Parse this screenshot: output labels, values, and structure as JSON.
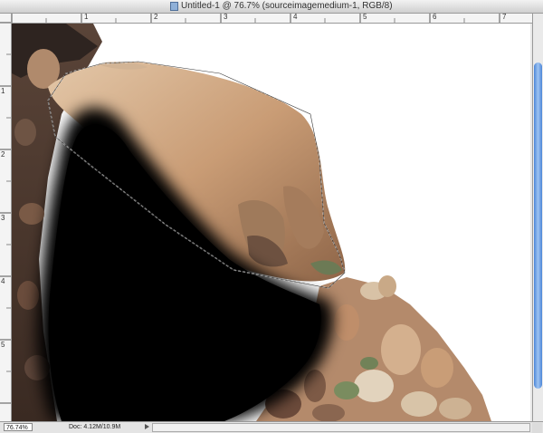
{
  "window": {
    "title": "Untitled-1 @ 76.7% (sourceimagemedium-1, RGB/8)"
  },
  "rulers": {
    "top_labels": [
      "1",
      "2",
      "3",
      "4",
      "5",
      "6",
      "7"
    ],
    "left_labels": [
      "1",
      "2",
      "3",
      "4",
      "5"
    ]
  },
  "status": {
    "zoom": "76.74%",
    "doc_info": "Doc: 4.12M/10.9M"
  },
  "colors": {
    "scroll_thumb": "#4c86d8",
    "mask_fill": "#000000",
    "canvas_bg": "#ffffff"
  }
}
